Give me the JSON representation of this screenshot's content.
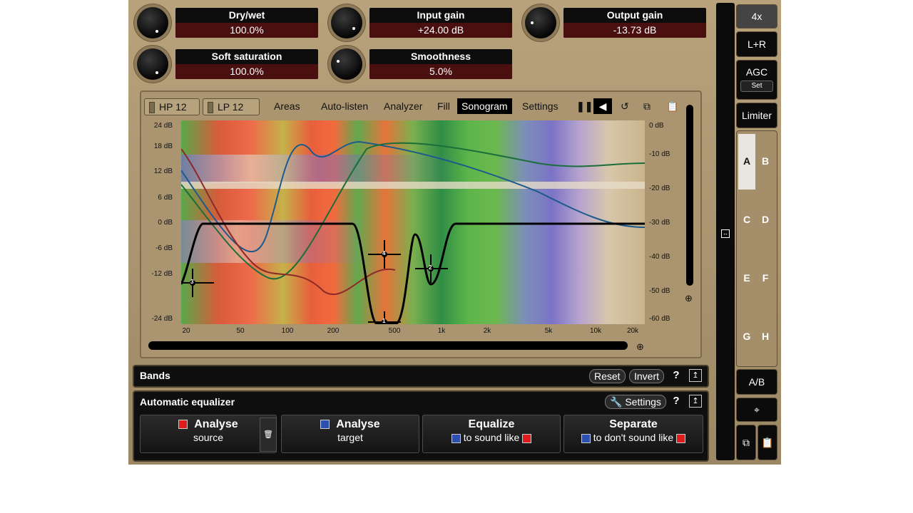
{
  "knobs": [
    {
      "label": "Dry/wet",
      "value": "100.0%"
    },
    {
      "label": "Input gain",
      "value": "+24.00 dB"
    },
    {
      "label": "Output gain",
      "value": "-13.73 dB"
    },
    {
      "label": "Soft saturation",
      "value": "100.0%"
    },
    {
      "label": "Smoothness",
      "value": "5.0%"
    }
  ],
  "toolbar": {
    "hp": "HP 12",
    "lp": "LP 12",
    "areas": "Areas",
    "autolisten": "Auto-listen",
    "analyzer": "Analyzer",
    "fill": "Fill",
    "sonogram": "Sonogram",
    "settings": "Settings"
  },
  "axis": {
    "left": [
      "24 dB",
      "18 dB",
      "12 dB",
      "6 dB",
      "0 dB",
      "-6 dB",
      "-12 dB",
      "-24 dB"
    ],
    "right": [
      "0 dB",
      "-10 dB",
      "-20 dB",
      "-30 dB",
      "-40 dB",
      "-50 dB",
      "-60 dB"
    ],
    "x": [
      "20",
      "50",
      "100",
      "200",
      "500",
      "1k",
      "2k",
      "5k",
      "10k",
      "20k"
    ]
  },
  "bands_bar": {
    "title": "Bands",
    "reset": "Reset",
    "invert": "Invert",
    "help": "?"
  },
  "auto_eq": {
    "title": "Automatic equalizer",
    "settings": "Settings",
    "help": "?",
    "buttons": [
      {
        "line1": "Analyse",
        "line2": "source"
      },
      {
        "line1": "Analyse",
        "line2": "target"
      },
      {
        "line1": "Equalize",
        "line2": "to sound like"
      },
      {
        "line1": "Separate",
        "line2": "to don't sound like"
      }
    ]
  },
  "side": {
    "oversample": "4x",
    "channel": "L+R",
    "agc": "AGC",
    "agc_set": "Set",
    "limiter": "Limiter",
    "ab": "A/B",
    "letters": [
      "A",
      "B",
      "C",
      "D",
      "E",
      "F",
      "G",
      "H"
    ]
  },
  "eq_nodes": [
    "1",
    "2",
    "3",
    "4"
  ]
}
